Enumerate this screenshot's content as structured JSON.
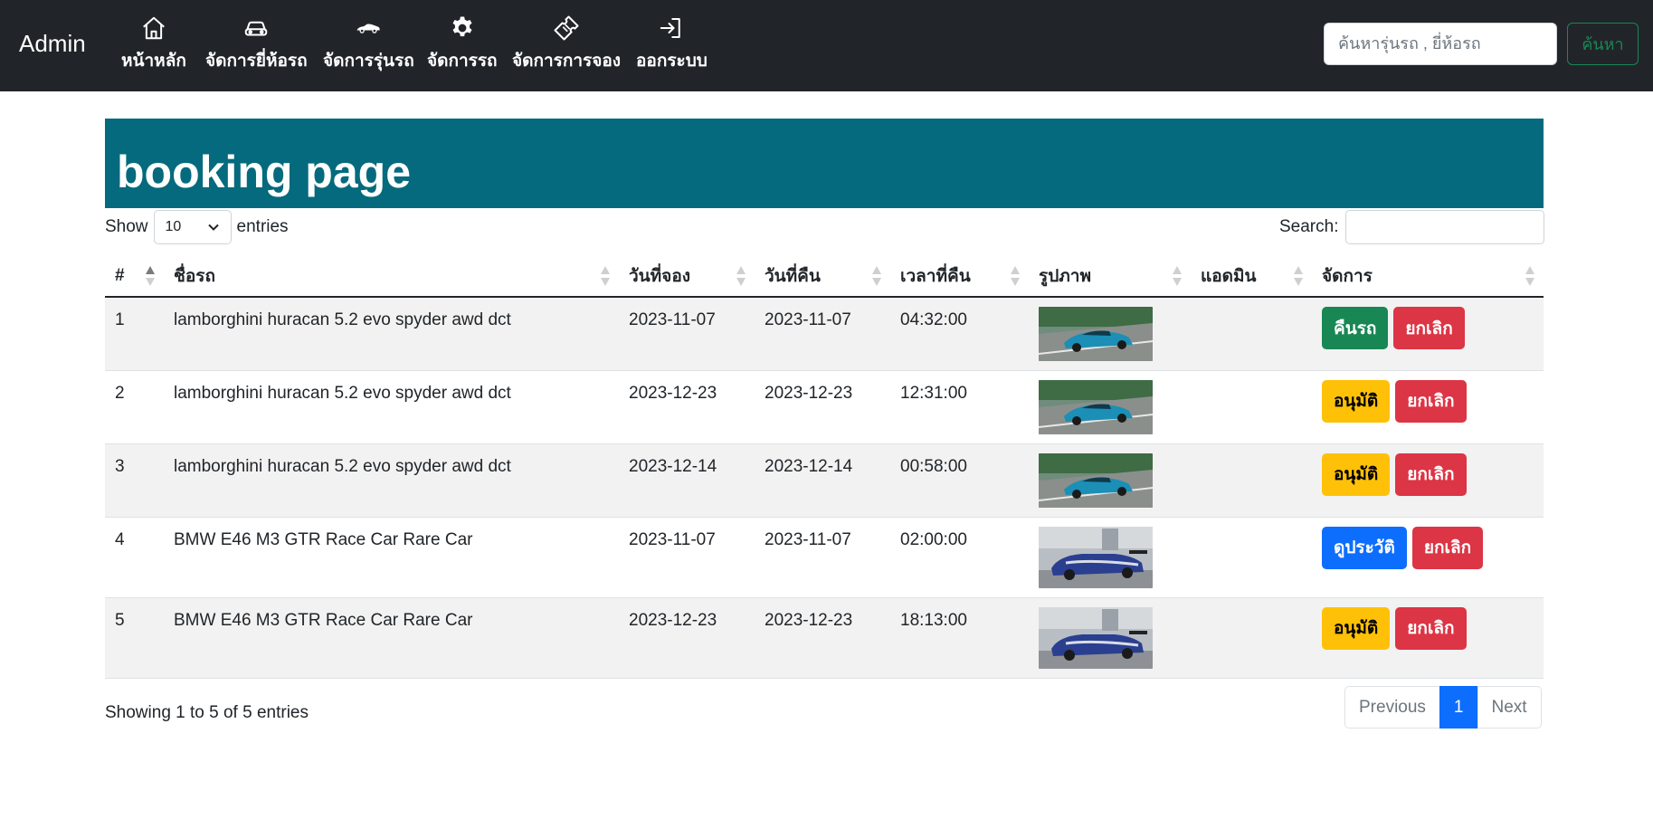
{
  "navbar": {
    "brand": "Admin",
    "items": [
      {
        "label": "หน้าหลัก",
        "icon": "house-icon"
      },
      {
        "label": "จัดการยี่ห้อรถ",
        "icon": "car-front-icon"
      },
      {
        "label": "จัดการรุ่นรถ",
        "icon": "sports-car-icon"
      },
      {
        "label": "จัดการรถ",
        "icon": "gear-icon"
      },
      {
        "label": "จัดการการจอง",
        "icon": "ticket-icon"
      },
      {
        "label": "ออกระบบ",
        "icon": "logout-icon"
      }
    ],
    "search_placeholder": "ค้นหารุ่นรถ , ยี่ห้อรถ",
    "search_button": "ค้นหา"
  },
  "page": {
    "title": "booking page"
  },
  "table_controls": {
    "show_label": "Show",
    "length_value": "10",
    "entries_label": "entries",
    "search_label": "Search:"
  },
  "table": {
    "columns": [
      "#",
      "ชื่อรถ",
      "วันที่จอง",
      "วันที่คืน",
      "เวลาที่คืน",
      "รูปภาพ",
      "แอดมิน",
      "จัดการ"
    ],
    "rows": [
      {
        "no": "1",
        "car": "lamborghini huracan 5.2 evo spyder awd dct",
        "booking_date": "2023-11-07",
        "return_date": "2023-11-07",
        "return_time": "04:32:00",
        "image": "lamborghini-photo",
        "admin": "",
        "actions": [
          {
            "label": "คืนรถ",
            "style": "success"
          },
          {
            "label": "ยกเลิก",
            "style": "danger"
          }
        ]
      },
      {
        "no": "2",
        "car": "lamborghini huracan 5.2 evo spyder awd dct",
        "booking_date": "2023-12-23",
        "return_date": "2023-12-23",
        "return_time": "12:31:00",
        "image": "lamborghini-photo",
        "admin": "",
        "actions": [
          {
            "label": "อนุมัติ",
            "style": "warning"
          },
          {
            "label": "ยกเลิก",
            "style": "danger"
          }
        ]
      },
      {
        "no": "3",
        "car": "lamborghini huracan 5.2 evo spyder awd dct",
        "booking_date": "2023-12-14",
        "return_date": "2023-12-14",
        "return_time": "00:58:00",
        "image": "lamborghini-photo",
        "admin": "",
        "actions": [
          {
            "label": "อนุมัติ",
            "style": "warning"
          },
          {
            "label": "ยกเลิก",
            "style": "danger"
          }
        ]
      },
      {
        "no": "4",
        "car": "BMW E46 M3 GTR Race Car Rare Car",
        "booking_date": "2023-11-07",
        "return_date": "2023-11-07",
        "return_time": "02:00:00",
        "image": "bmw-photo",
        "admin": "",
        "actions": [
          {
            "label": "ดูประวัติ",
            "style": "primary"
          },
          {
            "label": "ยกเลิก",
            "style": "danger"
          }
        ]
      },
      {
        "no": "5",
        "car": "BMW E46 M3 GTR Race Car Rare Car",
        "booking_date": "2023-12-23",
        "return_date": "2023-12-23",
        "return_time": "18:13:00",
        "image": "bmw-photo",
        "admin": "",
        "actions": [
          {
            "label": "อนุมัติ",
            "style": "warning"
          },
          {
            "label": "ยกเลิก",
            "style": "danger"
          }
        ]
      }
    ]
  },
  "footer": {
    "info": "Showing 1 to 5 of 5 entries",
    "pagination": {
      "previous": "Previous",
      "current": "1",
      "next": "Next"
    }
  },
  "colors": {
    "navbar_bg": "#212529",
    "banner_bg": "#056a7d",
    "success": "#198754",
    "danger": "#dc3545",
    "warning": "#ffc107",
    "primary": "#0d6efd"
  }
}
